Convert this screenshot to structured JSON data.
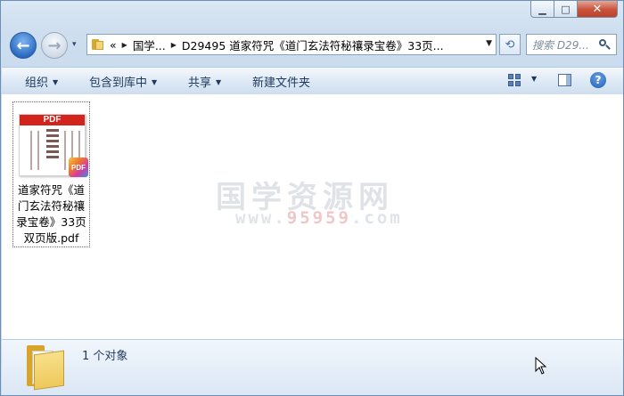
{
  "window": {
    "controls": {
      "minimize": "▁",
      "maximize": "□",
      "close": "✕"
    }
  },
  "nav": {
    "back_glyph": "←",
    "forward_glyph": "→",
    "history_glyph": "▾",
    "breadcrumb": {
      "overflow": "«",
      "segments": [
        "国学...",
        "D29495 道家符咒《道门玄法符秘禳录宝卷》33页..."
      ]
    },
    "refresh_glyph": "⟲",
    "search_placeholder": "搜索 D29..."
  },
  "toolbar": {
    "organize": "组织",
    "include_in_library": "包含到库中",
    "share": "共享",
    "new_folder": "新建文件夹",
    "help": "?"
  },
  "files": [
    {
      "name": "道家符咒《道门玄法符秘禳录宝卷》33页双页版.pdf",
      "thumbnail_banner": "PDF",
      "badge": "PDF"
    }
  ],
  "watermark": {
    "line1": "国学资源网",
    "line2_prefix": "www.",
    "line2_num": "95959",
    "line2_suffix": ".com"
  },
  "details": {
    "count_text": "1 个对象"
  },
  "colors": {
    "accent": "#1e395b",
    "pdf_red": "#d2231c",
    "close_red": "#c8523a"
  }
}
